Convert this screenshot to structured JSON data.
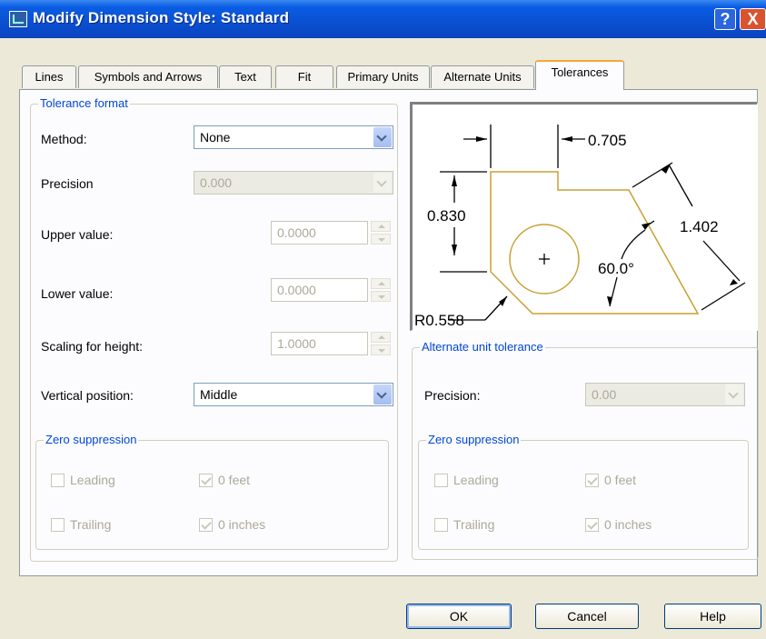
{
  "window": {
    "title": "Modify Dimension Style: Standard",
    "help_label": "?",
    "close_label": "X"
  },
  "tabs": [
    {
      "label": "Lines"
    },
    {
      "label": "Symbols and Arrows"
    },
    {
      "label": "Text"
    },
    {
      "label": "Fit"
    },
    {
      "label": "Primary Units"
    },
    {
      "label": "Alternate Units"
    },
    {
      "label": "Tolerances",
      "active": true
    }
  ],
  "tolerance_format": {
    "legend": "Tolerance format",
    "method": {
      "label": "Method:",
      "value": "None"
    },
    "precision": {
      "label": "Precision",
      "value": "0.000"
    },
    "upper_value": {
      "label": "Upper value:",
      "value": "0.0000"
    },
    "lower_value": {
      "label": "Lower value:",
      "value": "0.0000"
    },
    "scaling": {
      "label": "Scaling for height:",
      "value": "1.0000"
    },
    "vertical_position": {
      "label": "Vertical position:",
      "value": "Middle"
    },
    "zero_suppression": {
      "legend": "Zero suppression",
      "leading": "Leading",
      "trailing": "Trailing",
      "feet": "0 feet",
      "inches": "0 inches"
    }
  },
  "preview": {
    "dim_top": "0.705",
    "dim_left": "0.830",
    "dim_right": "1.402",
    "angle": "60.0°",
    "radius": "R0.558"
  },
  "alternate_unit_tolerance": {
    "legend": "Alternate unit tolerance",
    "precision": {
      "label": "Precision:",
      "value": "0.00"
    },
    "zero_suppression": {
      "legend": "Zero suppression",
      "leading": "Leading",
      "trailing": "Trailing",
      "feet": "0 feet",
      "inches": "0 inches"
    }
  },
  "buttons": {
    "ok": "OK",
    "cancel": "Cancel",
    "help": "Help"
  },
  "colors": {
    "title_bar": "#0a4fd1",
    "group_legend": "#0046d5",
    "preview_shape": "#c8a030"
  }
}
